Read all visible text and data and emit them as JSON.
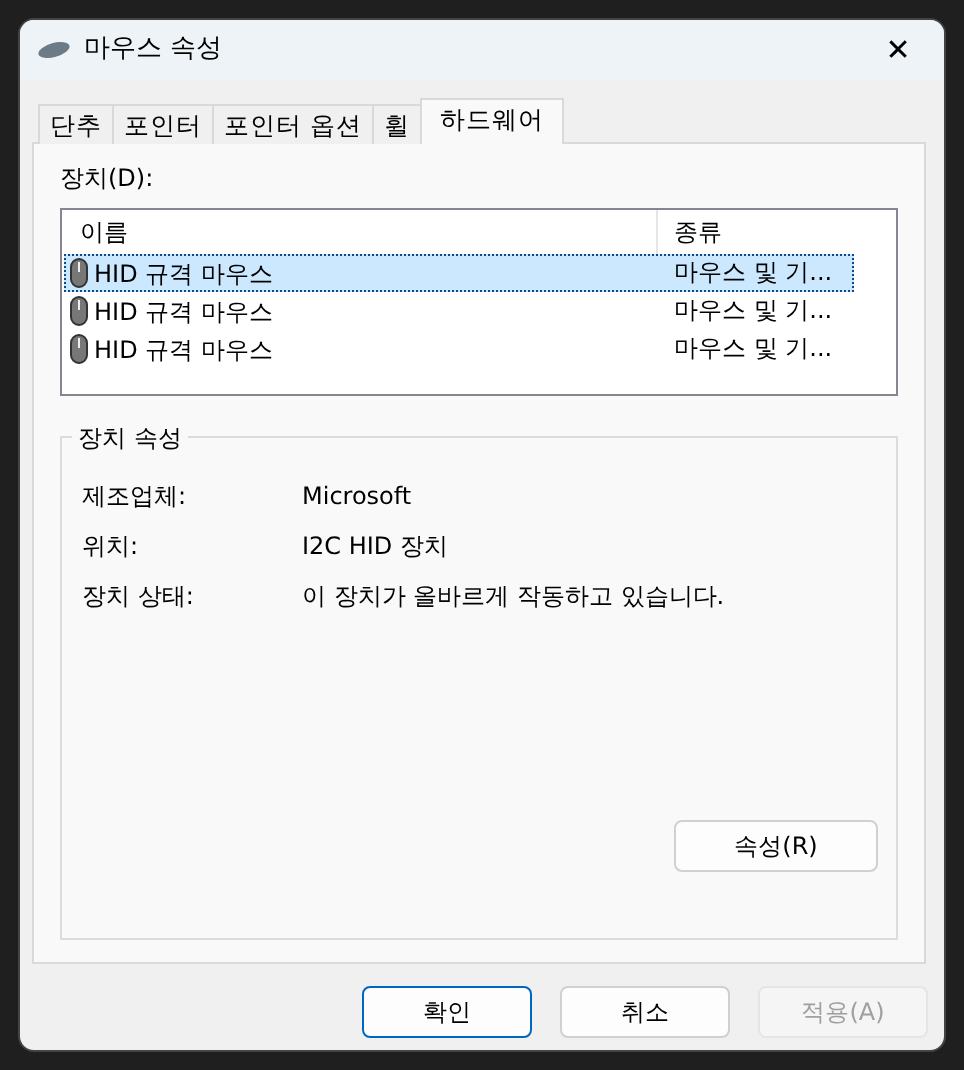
{
  "window": {
    "title": "마우스 속성",
    "close": "✕"
  },
  "tabs": [
    {
      "label": "단추",
      "selected": false
    },
    {
      "label": "포인터",
      "selected": false
    },
    {
      "label": "포인터 옵션",
      "selected": false
    },
    {
      "label": "휠",
      "selected": false
    },
    {
      "label": "하드웨어",
      "selected": true
    }
  ],
  "devices_label": "장치(D):",
  "device_table": {
    "columns": [
      "이름",
      "종류"
    ],
    "rows": [
      {
        "name": "HID 규격 마우스",
        "type": "마우스 및 기...",
        "selected": true
      },
      {
        "name": "HID 규격 마우스",
        "type": "마우스 및 기...",
        "selected": false
      },
      {
        "name": "HID 규격 마우스",
        "type": "마우스 및 기...",
        "selected": false
      }
    ]
  },
  "device_properties": {
    "title": "장치 속성",
    "fields": [
      {
        "label": "제조업체:",
        "value": "Microsoft"
      },
      {
        "label": "위치:",
        "value": "I2C HID 장치"
      },
      {
        "label": "장치 상태:",
        "value": "이 장치가 올바르게 작동하고 있습니다."
      }
    ],
    "button": "속성(R)"
  },
  "buttons": [
    {
      "label": "확인",
      "kind": "default",
      "disabled": false
    },
    {
      "label": "취소",
      "kind": "normal",
      "disabled": false
    },
    {
      "label": "적용(A)",
      "kind": "normal",
      "disabled": true
    }
  ]
}
